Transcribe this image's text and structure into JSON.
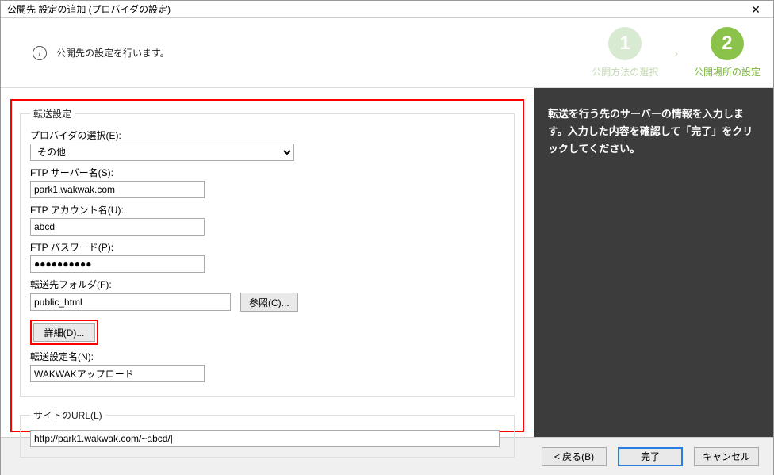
{
  "titlebar": {
    "title": "公開先 設定の追加 (プロバイダの設定)",
    "close": "✕"
  },
  "header": {
    "text": "公開先の設定を行います。"
  },
  "steps": {
    "step1_num": "1",
    "step1_label": "公開方法の選択",
    "arrow": "›",
    "step2_num": "2",
    "step2_label": "公開場所の設定"
  },
  "form": {
    "group1_legend": "転送設定",
    "provider_label": "プロバイダの選択(E):",
    "provider_value": "その他",
    "server_label": "FTP サーバー名(S):",
    "server_value": "park1.wakwak.com",
    "account_label": "FTP アカウント名(U):",
    "account_value": "abcd",
    "password_label": "FTP パスワード(P):",
    "password_value": "●●●●●●●●●●",
    "folder_label": "転送先フォルダ(F):",
    "folder_value": "public_html",
    "browse_btn": "参照(C)...",
    "detail_btn": "詳細(D)...",
    "name_label": "転送設定名(N):",
    "name_value": "WAKWAKアップロード",
    "group2_legend": "サイトのURL(L)",
    "url_value": "http://park1.wakwak.com/~abcd/|"
  },
  "sidebar": {
    "text": "転送を行う先のサーバーの情報を入力します。入力した内容を確認して「完了」をクリックしてください。"
  },
  "footer": {
    "back": "< 戻る(B)",
    "finish": "完了",
    "cancel": "キャンセル"
  }
}
